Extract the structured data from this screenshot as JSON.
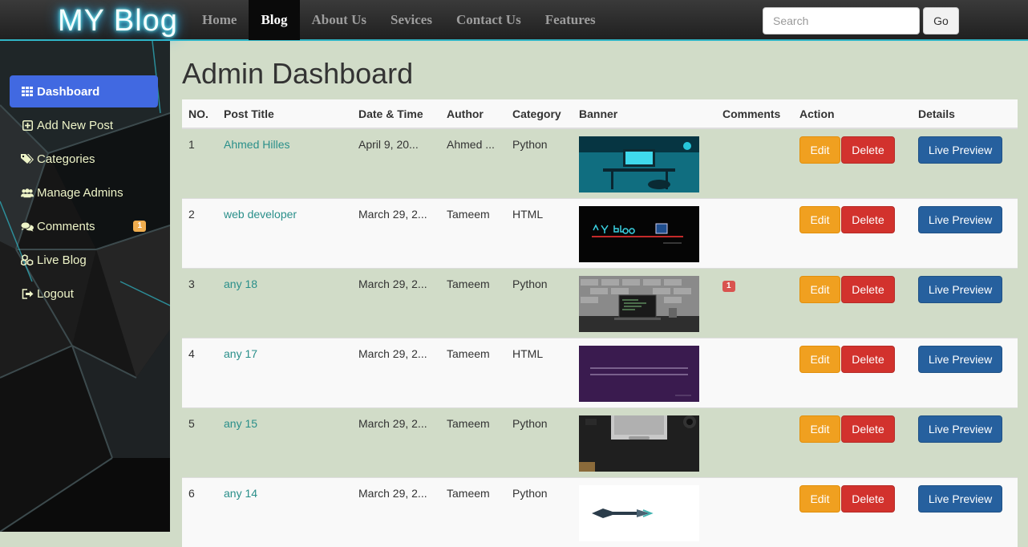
{
  "navbar": {
    "brand": "MY Blog",
    "links": [
      "Home",
      "Blog",
      "About Us",
      "Sevices",
      "Contact Us",
      "Features"
    ],
    "active_link": "Blog",
    "search_placeholder": "Search",
    "go_label": "Go"
  },
  "sidebar": {
    "items": [
      {
        "label": "Dashboard",
        "icon": "grid-icon",
        "active": true
      },
      {
        "label": "Add New Post",
        "icon": "plus-square-icon"
      },
      {
        "label": "Categories",
        "icon": "tags-icon"
      },
      {
        "label": "Manage Admins",
        "icon": "users-icon"
      },
      {
        "label": "Comments",
        "icon": "comments-icon",
        "badge": "1"
      },
      {
        "label": "Live Blog",
        "icon": "cubes-icon"
      },
      {
        "label": "Logout",
        "icon": "logout-icon"
      }
    ]
  },
  "main": {
    "title": "Admin Dashboard",
    "columns": [
      "NO.",
      "Post Title",
      "Date & Time",
      "Author",
      "Category",
      "Banner",
      "Comments",
      "Action",
      "Details"
    ],
    "actions": {
      "edit": "Edit",
      "delete": "Delete",
      "preview": "Live Preview"
    },
    "rows": [
      {
        "no": "1",
        "title": "Ahmed Hilles",
        "date": "April 9, 20...",
        "author": "Ahmed ...",
        "category": "Python",
        "banner": "teal-desk-setup",
        "comments": ""
      },
      {
        "no": "2",
        "title": "web developer",
        "date": "March 29, 2...",
        "author": "Tameem",
        "category": "HTML",
        "banner": "my-blog-logo-dark",
        "comments": ""
      },
      {
        "no": "3",
        "title": "any 18",
        "date": "March 29, 2...",
        "author": "Tameem",
        "category": "Python",
        "banner": "grey-laptop-brick-wall",
        "comments": "1"
      },
      {
        "no": "4",
        "title": "any 17",
        "date": "March 29, 2...",
        "author": "Tameem",
        "category": "HTML",
        "banner": "purple-lines",
        "comments": ""
      },
      {
        "no": "5",
        "title": "any 15",
        "date": "March 29, 2...",
        "author": "Tameem",
        "category": "Python",
        "banner": "laptop-dark-desk",
        "comments": ""
      },
      {
        "no": "6",
        "title": "any 14",
        "date": "March 29, 2...",
        "author": "Tameem",
        "category": "Python",
        "banner": "white-logo",
        "comments": ""
      }
    ]
  },
  "colors": {
    "accent": "#4169e1",
    "content_bg": "#d1dcc8",
    "link": "#2a8f8a",
    "edit": "#f0a020",
    "delete": "#d2322d",
    "preview": "#26609e",
    "badge_warning": "#f0ad4e",
    "badge_danger": "#d9534f"
  }
}
